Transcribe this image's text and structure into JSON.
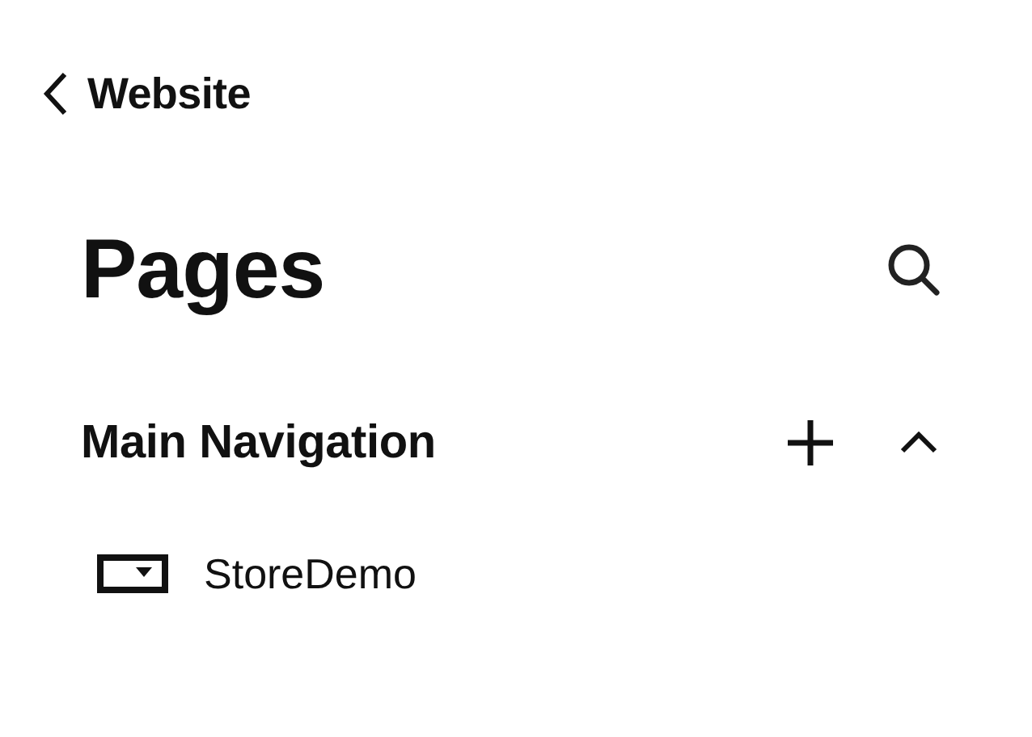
{
  "back_link": {
    "label": "Website"
  },
  "header": {
    "title": "Pages"
  },
  "sections": [
    {
      "title": "Main Navigation",
      "expanded": true,
      "pages": [
        {
          "label": "StoreDemo"
        }
      ]
    }
  ]
}
